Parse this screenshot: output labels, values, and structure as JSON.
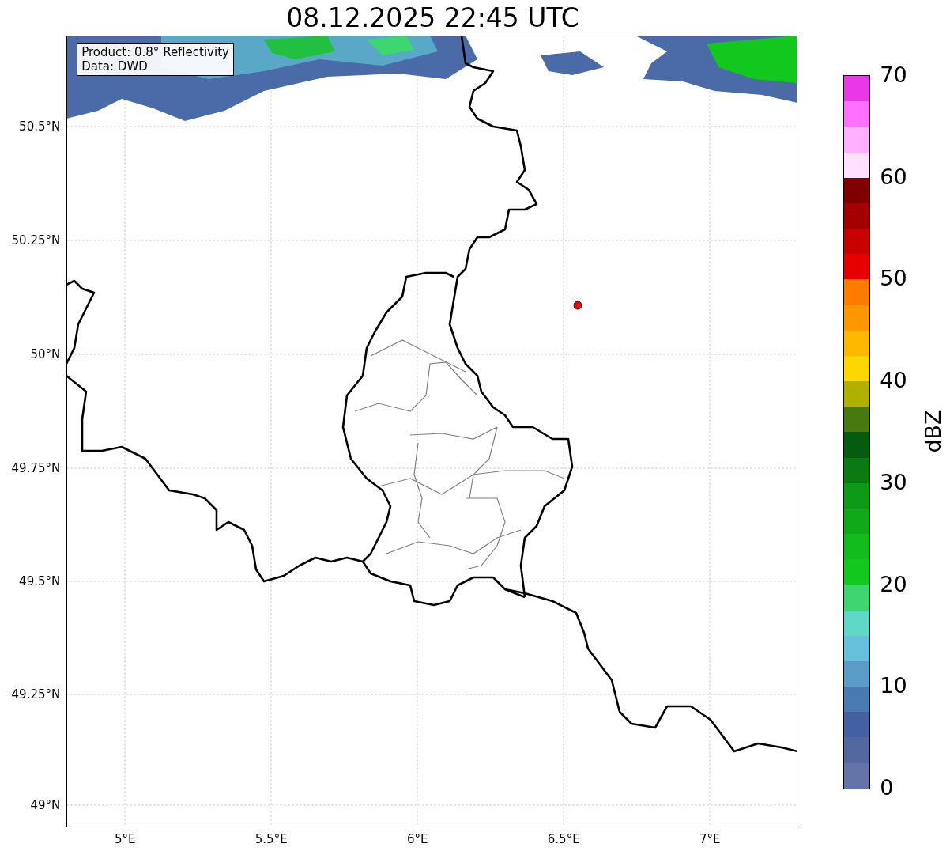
{
  "title": "08.12.2025 22:45 UTC",
  "map": {
    "annotation": [
      "Product: 0.8° Reflectivity",
      "Data: DWD"
    ],
    "y_ticks": [
      "50.5°N",
      "50.25°N",
      "50°N",
      "49.75°N",
      "49.5°N",
      "49.25°N",
      "49°N"
    ],
    "x_ticks": [
      "5°E",
      "5.5°E",
      "6°E",
      "6.5°E",
      "7°E"
    ]
  },
  "colorbar": {
    "label": "dBZ",
    "ticks": [
      "70",
      "60",
      "50",
      "40",
      "30",
      "20",
      "10",
      "0"
    ],
    "segments": [
      {
        "color": "#e838e8"
      },
      {
        "color": "#ff70ff"
      },
      {
        "color": "#ffb0ff"
      },
      {
        "color": "#ffe0ff"
      },
      {
        "color": "#800000"
      },
      {
        "color": "#a40000"
      },
      {
        "color": "#c80000"
      },
      {
        "color": "#e60000"
      },
      {
        "color": "#ff7c00"
      },
      {
        "color": "#ff9800"
      },
      {
        "color": "#ffb800"
      },
      {
        "color": "#ffd700"
      },
      {
        "color": "#b0b000"
      },
      {
        "color": "#467a10"
      },
      {
        "color": "#065c0e"
      },
      {
        "color": "#0a7a12"
      },
      {
        "color": "#0e9a16"
      },
      {
        "color": "#10aa18"
      },
      {
        "color": "#12bc1c"
      },
      {
        "color": "#12c81e"
      },
      {
        "color": "#3ed670"
      },
      {
        "color": "#60d8c8"
      },
      {
        "color": "#66c0dc"
      },
      {
        "color": "#5a9cc8"
      },
      {
        "color": "#4a7ab2"
      },
      {
        "color": "#4460a2"
      },
      {
        "color": "#5468a0"
      },
      {
        "color": "#6474a8"
      }
    ]
  }
}
